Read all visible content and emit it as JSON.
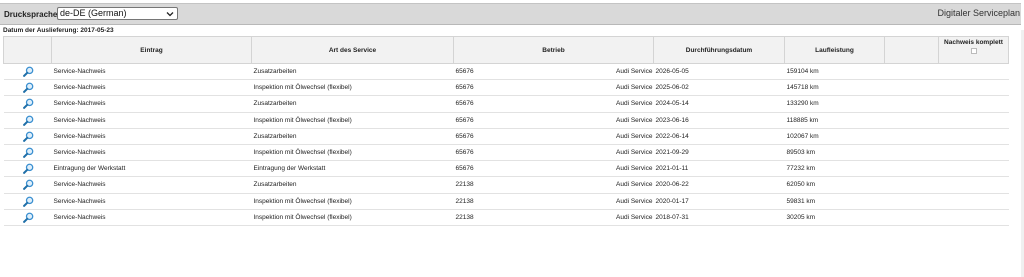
{
  "header": {
    "language_label": "Drucksprache:",
    "language_value": "de-DE (German)",
    "app_title": "Digitaler Serviceplan"
  },
  "delivery_date": "Datum der Auslieferung: 2017-05-23",
  "table": {
    "columns": [
      "Eintrag",
      "Art des Service",
      "Betrieb",
      "Durchführungsdatum",
      "Laufleistung",
      "",
      "Nachweis komplett"
    ],
    "rows": [
      {
        "eintrag": "Service-Nachweis",
        "art": "Zusatzarbeiten",
        "betrieb_nr": "65676",
        "betrieb_name": "Audi Service",
        "datum": "2026-05-05",
        "km": "159104 km"
      },
      {
        "eintrag": "Service-Nachweis",
        "art": "Inspektion mit Ölwechsel (flexibel)",
        "betrieb_nr": "65676",
        "betrieb_name": "Audi Service",
        "datum": "2025-06-02",
        "km": "145718 km"
      },
      {
        "eintrag": "Service-Nachweis",
        "art": "Zusatzarbeiten",
        "betrieb_nr": "65676",
        "betrieb_name": "Audi Service",
        "datum": "2024-05-14",
        "km": "133290 km"
      },
      {
        "eintrag": "Service-Nachweis",
        "art": "Inspektion mit Ölwechsel (flexibel)",
        "betrieb_nr": "65676",
        "betrieb_name": "Audi Service",
        "datum": "2023-06-16",
        "km": "118885 km"
      },
      {
        "eintrag": "Service-Nachweis",
        "art": "Zusatzarbeiten",
        "betrieb_nr": "65676",
        "betrieb_name": "Audi Service",
        "datum": "2022-06-14",
        "km": "102067 km"
      },
      {
        "eintrag": "Service-Nachweis",
        "art": "Inspektion mit Ölwechsel (flexibel)",
        "betrieb_nr": "65676",
        "betrieb_name": "Audi Service",
        "datum": "2021-09-29",
        "km": "89503 km"
      },
      {
        "eintrag": "Eintragung der Werkstatt",
        "art": "Eintragung der Werkstatt",
        "betrieb_nr": "65676",
        "betrieb_name": "Audi Service",
        "datum": "2021-01-11",
        "km": "77232 km"
      },
      {
        "eintrag": "Service-Nachweis",
        "art": "Zusatzarbeiten",
        "betrieb_nr": "22138",
        "betrieb_name": "Audi Service",
        "datum": "2020-06-22",
        "km": "62050 km"
      },
      {
        "eintrag": "Service-Nachweis",
        "art": "Inspektion mit Ölwechsel (flexibel)",
        "betrieb_nr": "22138",
        "betrieb_name": "Audi Service",
        "datum": "2020-01-17",
        "km": "59831 km"
      },
      {
        "eintrag": "Service-Nachweis",
        "art": "Inspektion mit Ölwechsel (flexibel)",
        "betrieb_nr": "22138",
        "betrieb_name": "Audi Service",
        "datum": "2018-07-31",
        "km": "30205 km"
      }
    ]
  },
  "icons": {
    "row_action": "magnifier-icon",
    "dropdown": "chevron-down-icon"
  },
  "colors": {
    "magnifier_handle": "#1f6fa8",
    "magnifier_lens": "#3a8fd0",
    "topbar": "#d9d9d9",
    "header_bg": "#f2f2f2"
  }
}
